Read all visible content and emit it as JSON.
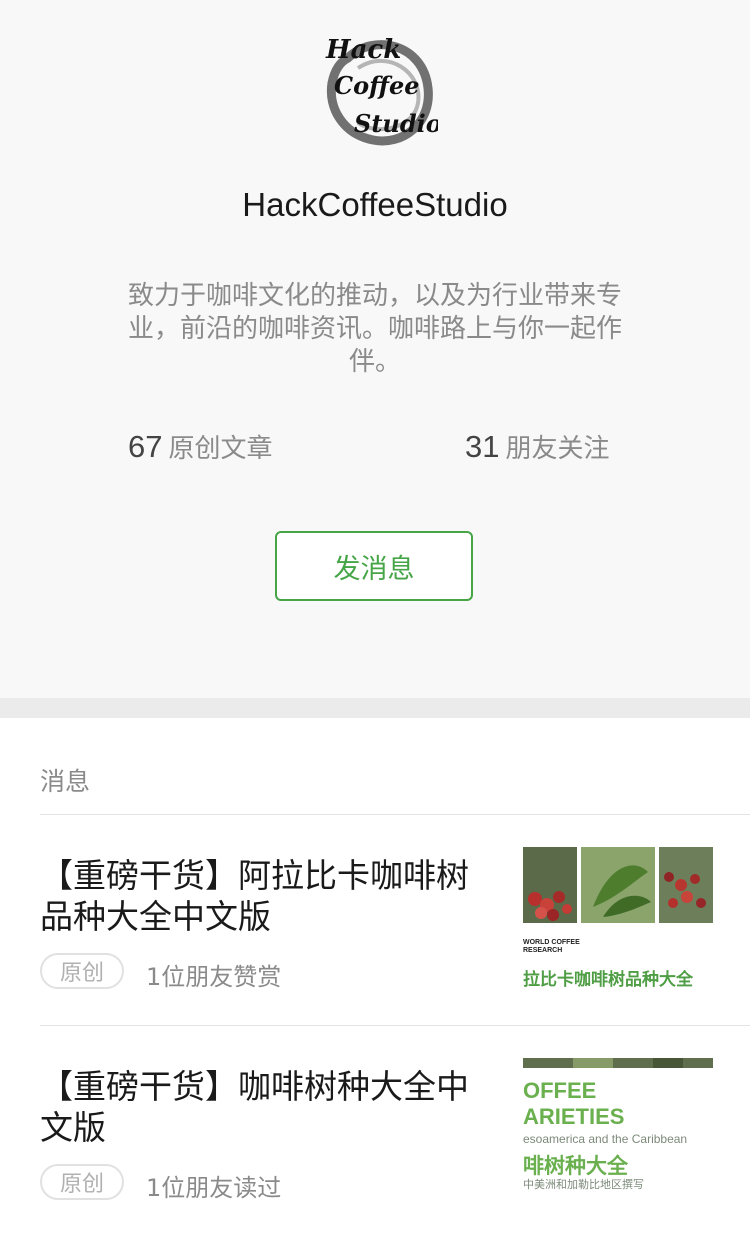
{
  "profile": {
    "name": "HackCoffeeStudio",
    "logo_text": [
      "Hack",
      "Coffee",
      "Studio"
    ],
    "bio_lines": [
      "致力于咖啡文化的推动，以及为行业带来专",
      "业，前沿的咖啡资讯。咖啡路上与你一起作",
      "伴。"
    ],
    "stats": {
      "original_count": "67",
      "original_label": "原创文章",
      "friends_count": "31",
      "friends_label": "朋友关注"
    },
    "message_button": "发消息"
  },
  "messages": {
    "section_title": "消息",
    "articles": [
      {
        "title": "【重磅干货】阿拉比卡咖啡树品种大全中文版",
        "badge": "原创",
        "meta": "1位朋友赞赏",
        "thumb_logo": "WORLD COFFEE RESEARCH",
        "thumb_caption": "拉比卡咖啡树品种大全"
      },
      {
        "title": "【重磅干货】咖啡树种大全中文版",
        "badge": "原创",
        "meta": "1位朋友读过",
        "thumb_line1": "OFFEE",
        "thumb_line2": "ARIETIES",
        "thumb_line3": "esoamerica and the Caribbean",
        "thumb_line4": "啡树种大全",
        "thumb_line5": "中美洲和加勒比地区撰写"
      }
    ]
  },
  "colors": {
    "accent_green": "#46a546",
    "profile_bg": "#f8f8f8",
    "text_gray": "#8a8a8a"
  }
}
